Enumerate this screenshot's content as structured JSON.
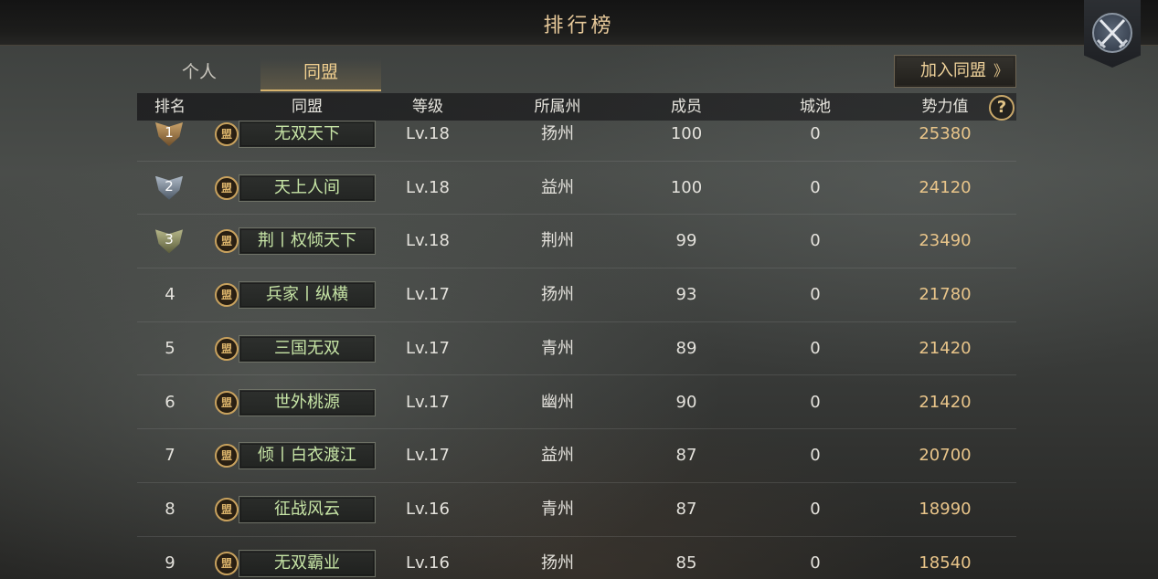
{
  "window": {
    "title": "排行榜"
  },
  "tabs": [
    {
      "label": "个人",
      "active": false
    },
    {
      "label": "同盟",
      "active": true
    }
  ],
  "join_button": {
    "label": "加入同盟",
    "chevron": "》"
  },
  "close_button": {
    "icon": "crossed-swords-icon"
  },
  "help_button": {
    "label": "?",
    "icon": "help-icon"
  },
  "table": {
    "columns": [
      "排名",
      "同盟",
      "等级",
      "所属州",
      "成员",
      "城池",
      "势力值"
    ],
    "flag_glyph": "盟",
    "rows": [
      {
        "rank": "1",
        "name": "无双天下",
        "level": "Lv.18",
        "state": "扬州",
        "members": "100",
        "cities": "0",
        "power": "25380"
      },
      {
        "rank": "2",
        "name": "天上人间",
        "level": "Lv.18",
        "state": "益州",
        "members": "100",
        "cities": "0",
        "power": "24120"
      },
      {
        "rank": "3",
        "name": "荆丨权倾天下",
        "level": "Lv.18",
        "state": "荆州",
        "members": "99",
        "cities": "0",
        "power": "23490"
      },
      {
        "rank": "4",
        "name": "兵家丨纵横",
        "level": "Lv.17",
        "state": "扬州",
        "members": "93",
        "cities": "0",
        "power": "21780"
      },
      {
        "rank": "5",
        "name": "三国无双",
        "level": "Lv.17",
        "state": "青州",
        "members": "89",
        "cities": "0",
        "power": "21420"
      },
      {
        "rank": "6",
        "name": "世外桃源",
        "level": "Lv.17",
        "state": "幽州",
        "members": "90",
        "cities": "0",
        "power": "21420"
      },
      {
        "rank": "7",
        "name": "倾丨白衣渡江",
        "level": "Lv.17",
        "state": "益州",
        "members": "87",
        "cities": "0",
        "power": "20700"
      },
      {
        "rank": "8",
        "name": "征战风云",
        "level": "Lv.16",
        "state": "青州",
        "members": "87",
        "cities": "0",
        "power": "18990"
      },
      {
        "rank": "9",
        "name": "无双霸业",
        "level": "Lv.16",
        "state": "扬州",
        "members": "85",
        "cities": "0",
        "power": "18540"
      }
    ]
  },
  "colors": {
    "accent_gold": "#e9c58a",
    "alliance_name": "#c7e5a6",
    "tab_active": "#f0cf8f"
  }
}
